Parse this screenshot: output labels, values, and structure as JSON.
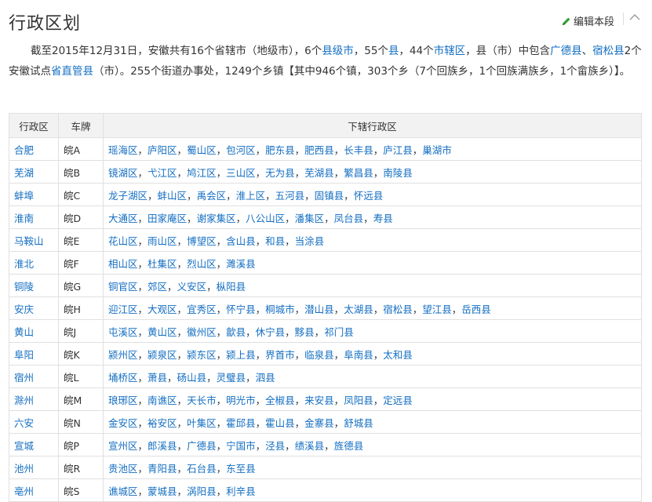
{
  "section": {
    "title": "行政区划",
    "edit_label": "编辑本段"
  },
  "intro": {
    "p1": "截至2015年12月31日，安徽共有16个省辖市（地级市），6个",
    "l1": "县级市",
    "p2": "，55个",
    "l2": "县",
    "p3": "，44个",
    "l3": "市辖区",
    "p4": "，县（市）中包含",
    "l4": "广德县",
    "p5": "、",
    "l5": "宿松县",
    "p6": "2个安徽试点",
    "l6": "省直管县",
    "p7": "（市）。255个街道办事处，1249个乡镇【其中946个镇，303个乡（7个回族乡，1个回族满族乡，1个畲族乡）】。"
  },
  "table": {
    "headers": [
      "行政区",
      "车牌",
      "下辖行政区"
    ],
    "rows": [
      {
        "city": "合肥",
        "plate": "皖A",
        "districts": [
          "瑶海区",
          "庐阳区",
          "蜀山区",
          "包河区",
          "肥东县",
          "肥西县",
          "长丰县",
          "庐江县",
          "巢湖市"
        ]
      },
      {
        "city": "芜湖",
        "plate": "皖B",
        "districts": [
          "镜湖区",
          "弋江区",
          "鸠江区",
          "三山区",
          "无为县",
          "芜湖县",
          "繁昌县",
          "南陵县"
        ]
      },
      {
        "city": "蚌埠",
        "plate": "皖C",
        "districts": [
          "龙子湖区",
          "蚌山区",
          "禹会区",
          "淮上区",
          "五河县",
          "固镇县",
          "怀远县"
        ]
      },
      {
        "city": "淮南",
        "plate": "皖D",
        "districts": [
          "大通区",
          "田家庵区",
          "谢家集区",
          "八公山区",
          "潘集区",
          "凤台县",
          "寿县"
        ]
      },
      {
        "city": "马鞍山",
        "plate": "皖E",
        "districts": [
          "花山区",
          "雨山区",
          "博望区",
          "含山县",
          "和县",
          "当涂县"
        ]
      },
      {
        "city": "淮北",
        "plate": "皖F",
        "districts": [
          "相山区",
          "杜集区",
          "烈山区",
          "濉溪县"
        ]
      },
      {
        "city": "铜陵",
        "plate": "皖G",
        "districts": [
          "铜官区",
          "郊区",
          "义安区",
          "枞阳县"
        ]
      },
      {
        "city": "安庆",
        "plate": "皖H",
        "districts": [
          "迎江区",
          "大观区",
          "宜秀区",
          "怀宁县",
          "桐城市",
          "潜山县",
          "太湖县",
          "宿松县",
          "望江县",
          "岳西县"
        ]
      },
      {
        "city": "黄山",
        "plate": "皖J",
        "districts": [
          "屯溪区",
          "黄山区",
          "徽州区",
          "歙县",
          "休宁县",
          "黟县",
          "祁门县"
        ]
      },
      {
        "city": "阜阳",
        "plate": "皖K",
        "districts": [
          "颍州区",
          "颍泉区",
          "颍东区",
          "颍上县",
          "界首市",
          "临泉县",
          "阜南县",
          "太和县"
        ]
      },
      {
        "city": "宿州",
        "plate": "皖L",
        "districts": [
          "埇桥区",
          "萧县",
          "砀山县",
          "灵璧县",
          "泗县"
        ]
      },
      {
        "city": "滁州",
        "plate": "皖M",
        "districts": [
          "琅琊区",
          "南谯区",
          "天长市",
          "明光市",
          "全椒县",
          "来安县",
          "凤阳县",
          "定远县"
        ]
      },
      {
        "city": "六安",
        "plate": "皖N",
        "districts": [
          "金安区",
          "裕安区",
          "叶集区",
          "霍邱县",
          "霍山县",
          "金寨县",
          "舒城县"
        ]
      },
      {
        "city": "宣城",
        "plate": "皖P",
        "districts": [
          "宣州区",
          "郎溪县",
          "广德县",
          "宁国市",
          "泾县",
          "绩溪县",
          "旌德县"
        ]
      },
      {
        "city": "池州",
        "plate": "皖R",
        "districts": [
          "贵池区",
          "青阳县",
          "石台县",
          "东至县"
        ]
      },
      {
        "city": "亳州",
        "plate": "皖S",
        "districts": [
          "谯城区",
          "蒙城县",
          "涡阳县",
          "利辛县"
        ]
      }
    ]
  },
  "colors": {
    "link": "#136ec2",
    "header_bg": "#f2f2f2",
    "border": "#e0e0e0",
    "edit_icon": "#2e9c2e"
  },
  "icons": {
    "edit": "pencil-icon",
    "collapse": "chevron-up-icon"
  }
}
